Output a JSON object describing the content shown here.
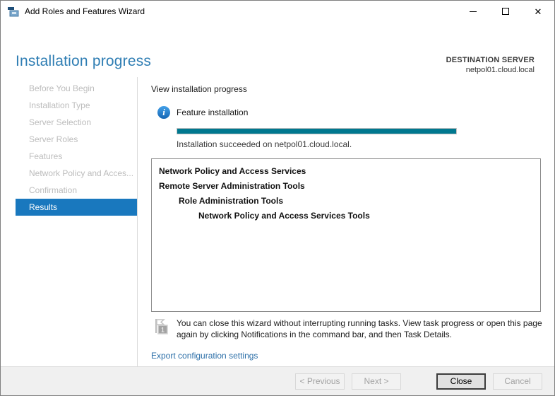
{
  "window": {
    "title": "Add Roles and Features Wizard",
    "controls": {
      "minimize": "minimize",
      "maximize": "maximize",
      "close": "close"
    }
  },
  "header": {
    "title": "Installation progress",
    "destination_label": "DESTINATION SERVER",
    "destination_server": "netpol01.cloud.local"
  },
  "sidebar": {
    "items": [
      {
        "label": "Before You Begin",
        "state": "disabled"
      },
      {
        "label": "Installation Type",
        "state": "disabled"
      },
      {
        "label": "Server Selection",
        "state": "disabled"
      },
      {
        "label": "Server Roles",
        "state": "disabled"
      },
      {
        "label": "Features",
        "state": "disabled"
      },
      {
        "label": "Network Policy and Acces...",
        "state": "disabled"
      },
      {
        "label": "Confirmation",
        "state": "disabled"
      },
      {
        "label": "Results",
        "state": "selected"
      }
    ]
  },
  "main": {
    "view_label": "View installation progress",
    "feature": {
      "title": "Feature installation",
      "progress_percent": 100,
      "status": "Installation succeeded on netpol01.cloud.local."
    },
    "installed_items": [
      {
        "label": "Network Policy and Access Services",
        "indent": 0
      },
      {
        "label": "Remote Server Administration Tools",
        "indent": 0
      },
      {
        "label": "Role Administration Tools",
        "indent": 1
      },
      {
        "label": "Network Policy and Access Services Tools",
        "indent": 2
      }
    ],
    "notice": {
      "badge": "1",
      "text": "You can close this wizard without interrupting running tasks. View task progress or open this page again by clicking Notifications in the command bar, and then Task Details."
    },
    "export_link": "Export configuration settings"
  },
  "footer": {
    "buttons": [
      {
        "label": "< Previous",
        "enabled": false
      },
      {
        "label": "Next >",
        "enabled": false
      },
      {
        "label": "Close",
        "enabled": true
      },
      {
        "label": "Cancel",
        "enabled": false
      }
    ]
  },
  "colors": {
    "heading_blue": "#2e7db3",
    "selection_blue": "#1978be",
    "progress_teal": "#00788f",
    "link_blue": "#2c6fa8",
    "disabled_text": "#bcbcbc"
  }
}
